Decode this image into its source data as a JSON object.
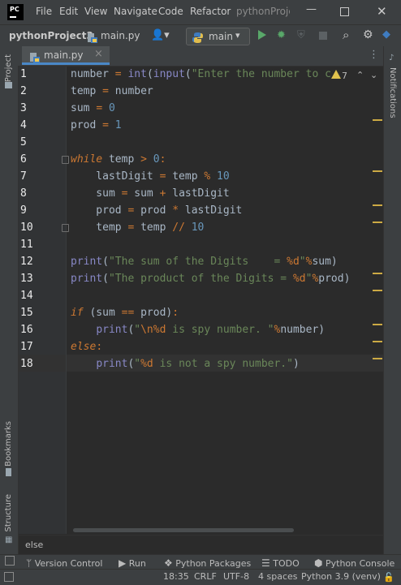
{
  "titlebar": {
    "app_icon": "PC",
    "menus": [
      "File",
      "Edit",
      "View",
      "Navigate",
      "Code",
      "Refactor"
    ],
    "project_title": "pythonProjec",
    "window_controls": [
      "minimize-icon",
      "maximize-icon",
      "close-icon"
    ]
  },
  "navbar": {
    "project": "pythonProject3",
    "file": "main.py",
    "run_config": "main"
  },
  "tabs": [
    {
      "label": "main.py",
      "close": "×"
    }
  ],
  "editor": {
    "inspection_warnings": "7",
    "line_numbers": [
      "1",
      "2",
      "3",
      "4",
      "5",
      "6",
      "7",
      "8",
      "9",
      "10",
      "11",
      "12",
      "13",
      "14",
      "15",
      "16",
      "17",
      "18"
    ],
    "current_line": 18,
    "code": [
      "number = int(input(\"Enter the number to c",
      "temp = number",
      "sum = 0",
      "prod = 1",
      "",
      "while temp > 0:",
      "    lastDigit = temp % 10",
      "    sum = sum + lastDigit",
      "    prod = prod * lastDigit",
      "    temp = temp // 10",
      "",
      "print(\"The sum of the Digits    = %d\"%sum)",
      "print(\"The product of the Digits = %d\"%prod)",
      "",
      "if (sum == prod):",
      "    print(\"\\n%d is spy number. \"%number)",
      "else:",
      "    print(\"%d is not a spy number.\")"
    ]
  },
  "breadcrumb": "else",
  "side_tools": {
    "left": [
      "Project",
      "Bookmarks",
      "Structure"
    ],
    "right": [
      "Notifications"
    ]
  },
  "tool_windows": [
    {
      "label": "Version Control",
      "icon": "branch-icon"
    },
    {
      "label": "Run",
      "icon": "play-icon"
    },
    {
      "label": "Python Packages",
      "icon": "packages-icon"
    },
    {
      "label": "TODO",
      "icon": "list-icon"
    },
    {
      "label": "Python Console",
      "icon": "python-icon"
    }
  ],
  "status": {
    "position": "18:35",
    "line_sep": "CRLF",
    "encoding": "UTF-8",
    "indent": "4 spaces",
    "interpreter": "Python 3.9 (venv)"
  },
  "colors": {
    "background": "#2b2b2b",
    "chrome": "#3c3f41",
    "keyword": "#cc7832",
    "string": "#6a8759",
    "number": "#6897bb",
    "builtin": "#8888c6",
    "warning_mark": "#ccaa44"
  }
}
